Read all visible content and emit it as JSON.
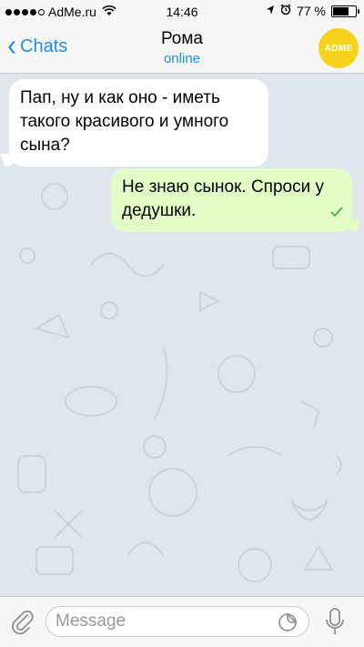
{
  "status_bar": {
    "carrier": "AdMe.ru",
    "time": "14:46",
    "battery_text": "77 %",
    "battery_level": 0.77,
    "signal_bars_filled": 4,
    "icons": [
      "signal-icon",
      "wifi-icon",
      "location-icon",
      "alarm-icon",
      "battery-icon"
    ]
  },
  "nav": {
    "back_label": "Chats",
    "contact_name": "Рома",
    "contact_status": "online",
    "avatar_text": "ADME",
    "accent_color": "#1d8cf8",
    "avatar_color": "#f7d21d"
  },
  "messages": [
    {
      "direction": "incoming",
      "text": "Пап, ну и как оно - иметь такого красивого и умного сына?"
    },
    {
      "direction": "outgoing",
      "text": "Не знаю сынок. Спроси у дедушки.",
      "status_icon": "check-icon"
    }
  ],
  "input": {
    "placeholder": "Message",
    "value": ""
  },
  "colors": {
    "outgoing_bubble": "#e2fdc5",
    "incoming_bubble": "#ffffff",
    "wallpaper": "#dfe6ec",
    "check": "#3fb54a"
  }
}
